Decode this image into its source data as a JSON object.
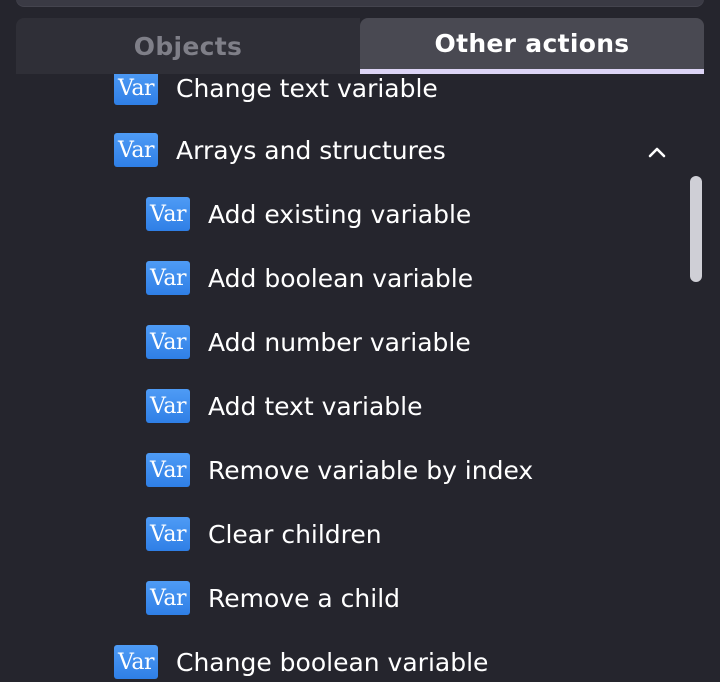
{
  "tabs": {
    "objects": "Objects",
    "other_actions": "Other actions"
  },
  "icon_label": "Var",
  "items": {
    "top_partial": "Change text variable",
    "group": "Arrays and structures",
    "children": [
      "Add existing variable",
      "Add boolean variable",
      "Add number variable",
      "Add text variable",
      "Remove variable by index",
      "Clear children",
      "Remove a child"
    ],
    "bottom": "Change boolean variable"
  },
  "colors": {
    "background": "#25252d",
    "tab_active_bg": "#494952",
    "tab_active_indicator": "#dcd4f5",
    "var_icon": "#3b8bee"
  }
}
